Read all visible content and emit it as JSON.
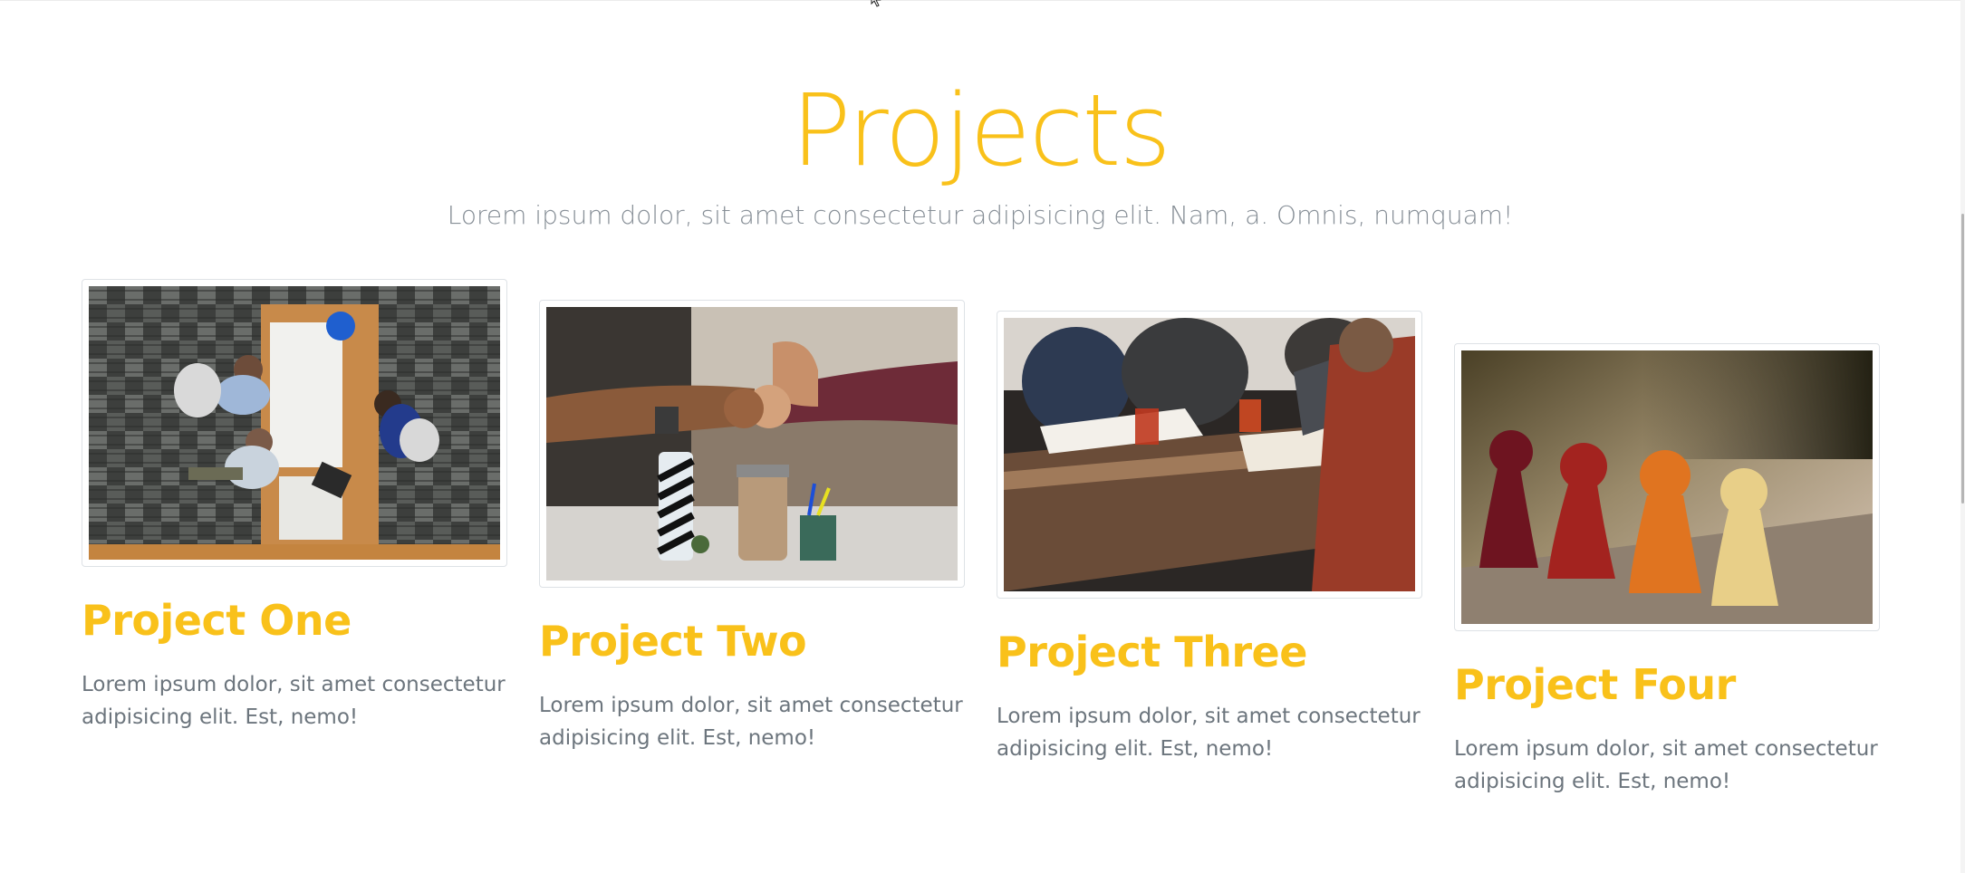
{
  "colors": {
    "accent": "#f9c11a",
    "muted_text": "#6c757d",
    "border": "#dee2e6"
  },
  "section": {
    "title": "Projects",
    "subtitle": "Lorem ipsum dolor, sit amet consectetur adipisicing elit. Nam, a. Omnis, numquam!"
  },
  "projects": [
    {
      "title": "Project One",
      "description": "Lorem ipsum dolor, sit amet consectetur adipisicing elit. Est, nemo!",
      "image": "team-meeting-overhead-photo"
    },
    {
      "title": "Project Two",
      "description": "Lorem ipsum dolor, sit amet consectetur adipisicing elit. Est, nemo!",
      "image": "fist-bump-photo"
    },
    {
      "title": "Project Three",
      "description": "Lorem ipsum dolor, sit amet consectetur adipisicing elit. Est, nemo!",
      "image": "people-at-table-laptops-photo"
    },
    {
      "title": "Project Four",
      "description": "Lorem ipsum dolor, sit amet consectetur adipisicing elit. Est, nemo!",
      "image": "wooden-game-pieces-photo"
    }
  ],
  "icons": {
    "cursor": "mouse-pointer-icon"
  }
}
